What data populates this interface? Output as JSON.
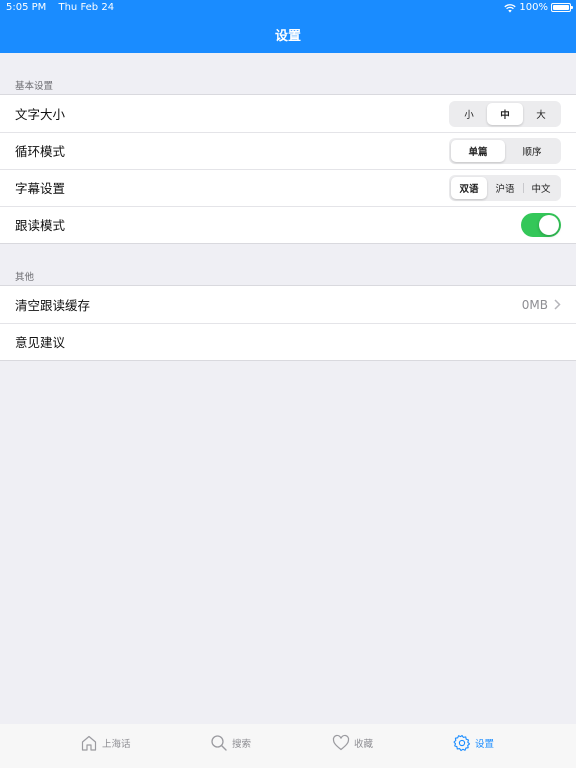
{
  "status_bar": {
    "time": "5:05 PM",
    "date": "Thu Feb 24",
    "battery": "100%"
  },
  "nav": {
    "title": "设置"
  },
  "sections": {
    "basic": {
      "label": "基本设置",
      "font_size": {
        "label": "文字大小",
        "options": [
          "小",
          "中",
          "大"
        ],
        "selected": "中"
      },
      "loop_mode": {
        "label": "循环模式",
        "options": [
          "单篇",
          "顺序"
        ],
        "selected": "单篇"
      },
      "subtitle": {
        "label": "字幕设置",
        "options": [
          "双语",
          "沪语",
          "中文"
        ],
        "selected": "双语"
      },
      "follow_read": {
        "label": "跟读模式",
        "enabled": true
      }
    },
    "other": {
      "label": "其他",
      "clear_cache": {
        "label": "清空跟读缓存",
        "value": "0MB"
      },
      "feedback": {
        "label": "意见建议"
      }
    }
  },
  "tabbar": {
    "items": [
      {
        "label": "上海话",
        "icon": "home-icon",
        "active": false
      },
      {
        "label": "搜索",
        "icon": "search-icon",
        "active": false
      },
      {
        "label": "收藏",
        "icon": "heart-icon",
        "active": false
      },
      {
        "label": "设置",
        "icon": "gear-icon",
        "active": true
      }
    ]
  },
  "colors": {
    "accent": "#1a8cff",
    "toggle_on": "#34c759",
    "background": "#efeff4"
  }
}
